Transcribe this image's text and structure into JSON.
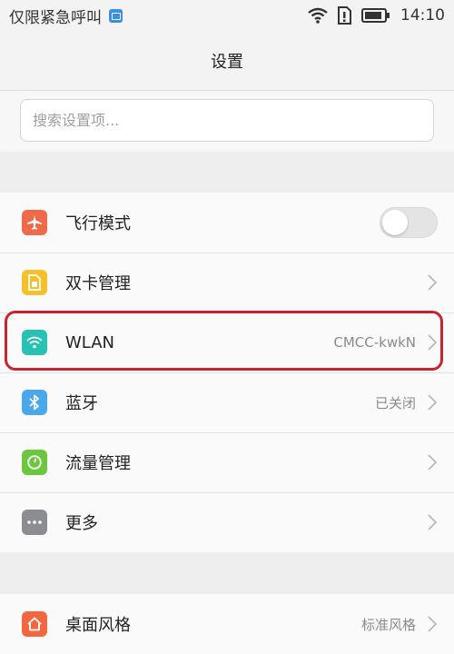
{
  "status_bar": {
    "carrier": "仅限紧急呼叫",
    "time": "14:10",
    "icons": [
      "image-notification-icon",
      "wifi-icon",
      "no-sim-icon",
      "battery-icon"
    ]
  },
  "header": {
    "title": "设置"
  },
  "search": {
    "placeholder": "搜索设置项..."
  },
  "list1": [
    {
      "label": "飞行模式",
      "icon": "airplane-icon",
      "icon_color": "#f06a4a",
      "control": "toggle",
      "state": "off"
    },
    {
      "label": "双卡管理",
      "icon": "sim-card-icon",
      "icon_color": "#f5c02a",
      "value": ""
    },
    {
      "label": "WLAN",
      "icon": "wifi-icon",
      "icon_color": "#28c2b4",
      "value": "CMCC-kwkN",
      "highlighted": true
    },
    {
      "label": "蓝牙",
      "icon": "bluetooth-icon",
      "icon_color": "#4aa7ea",
      "value": "已关闭"
    },
    {
      "label": "流量管理",
      "icon": "data-usage-icon",
      "icon_color": "#6cc73c",
      "value": ""
    },
    {
      "label": "更多",
      "icon": "more-icon",
      "icon_color": "#8c8c93",
      "value": ""
    }
  ],
  "list2": [
    {
      "label": "桌面风格",
      "icon": "home-icon",
      "icon_color": "#f2673f",
      "value": "标准风格"
    }
  ],
  "colors": {
    "highlight_border": "#c9242e"
  }
}
